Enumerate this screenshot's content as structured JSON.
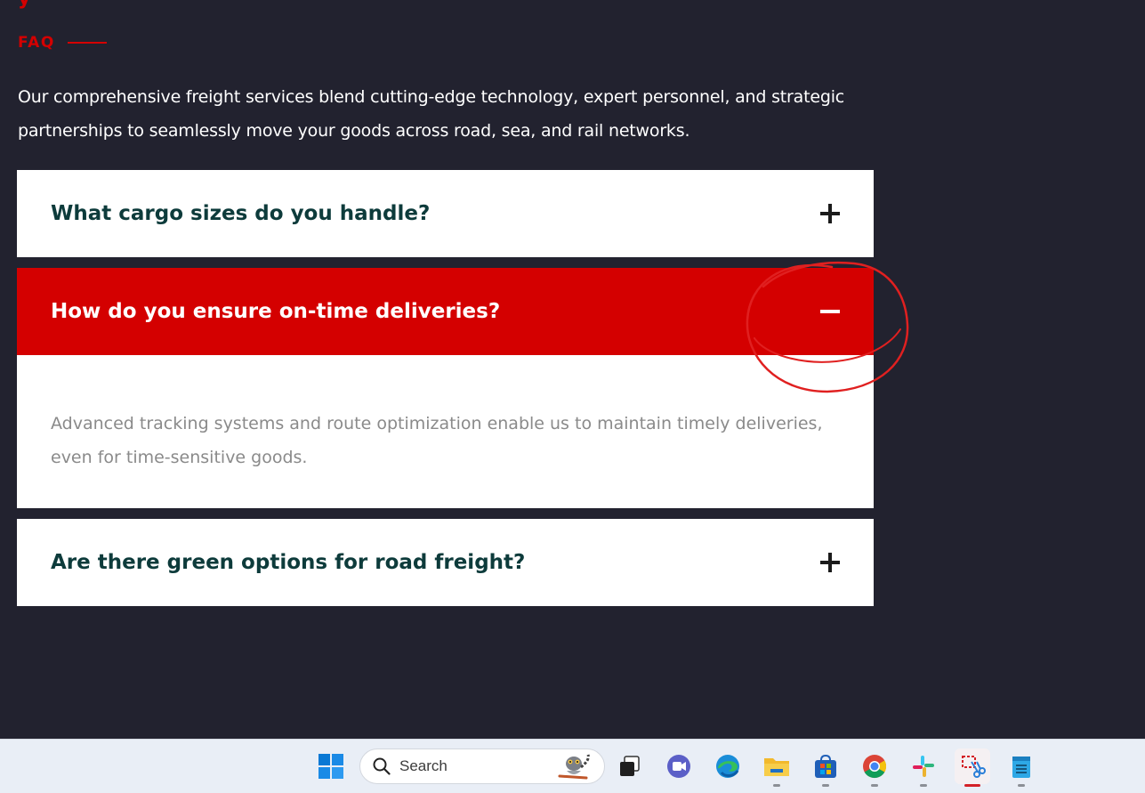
{
  "faq": {
    "eyebrow": "FAQ",
    "intro": "Our comprehensive freight services blend cutting-edge technology, expert personnel, and strategic partnerships to seamlessly move your goods across road, sea, and rail networks.",
    "items": [
      {
        "question": "What cargo sizes do you handle?",
        "state": "collapsed",
        "icon": "plus-icon"
      },
      {
        "question": "How do you ensure on-time deliveries?",
        "state": "expanded",
        "icon": "minus-icon",
        "answer": "Advanced tracking systems and route optimization enable us to maintain timely deliveries, even for time-sensitive goods."
      },
      {
        "question": "Are there green options for road freight?",
        "state": "collapsed",
        "icon": "plus-icon"
      }
    ]
  },
  "colors": {
    "background": "#22222f",
    "accent": "#d40000",
    "question_text": "#0d3b3b",
    "answer_text": "#8a8a8a",
    "annotation": "#e02020"
  },
  "taskbar": {
    "search_placeholder": "Search",
    "apps": [
      "windows-start-icon",
      "search-icon",
      "task-view-icon",
      "teams-meet-icon",
      "edge-icon",
      "file-explorer-icon",
      "microsoft-store-icon",
      "chrome-icon",
      "slack-icon",
      "snipping-tool-icon",
      "notepad-icon"
    ]
  }
}
